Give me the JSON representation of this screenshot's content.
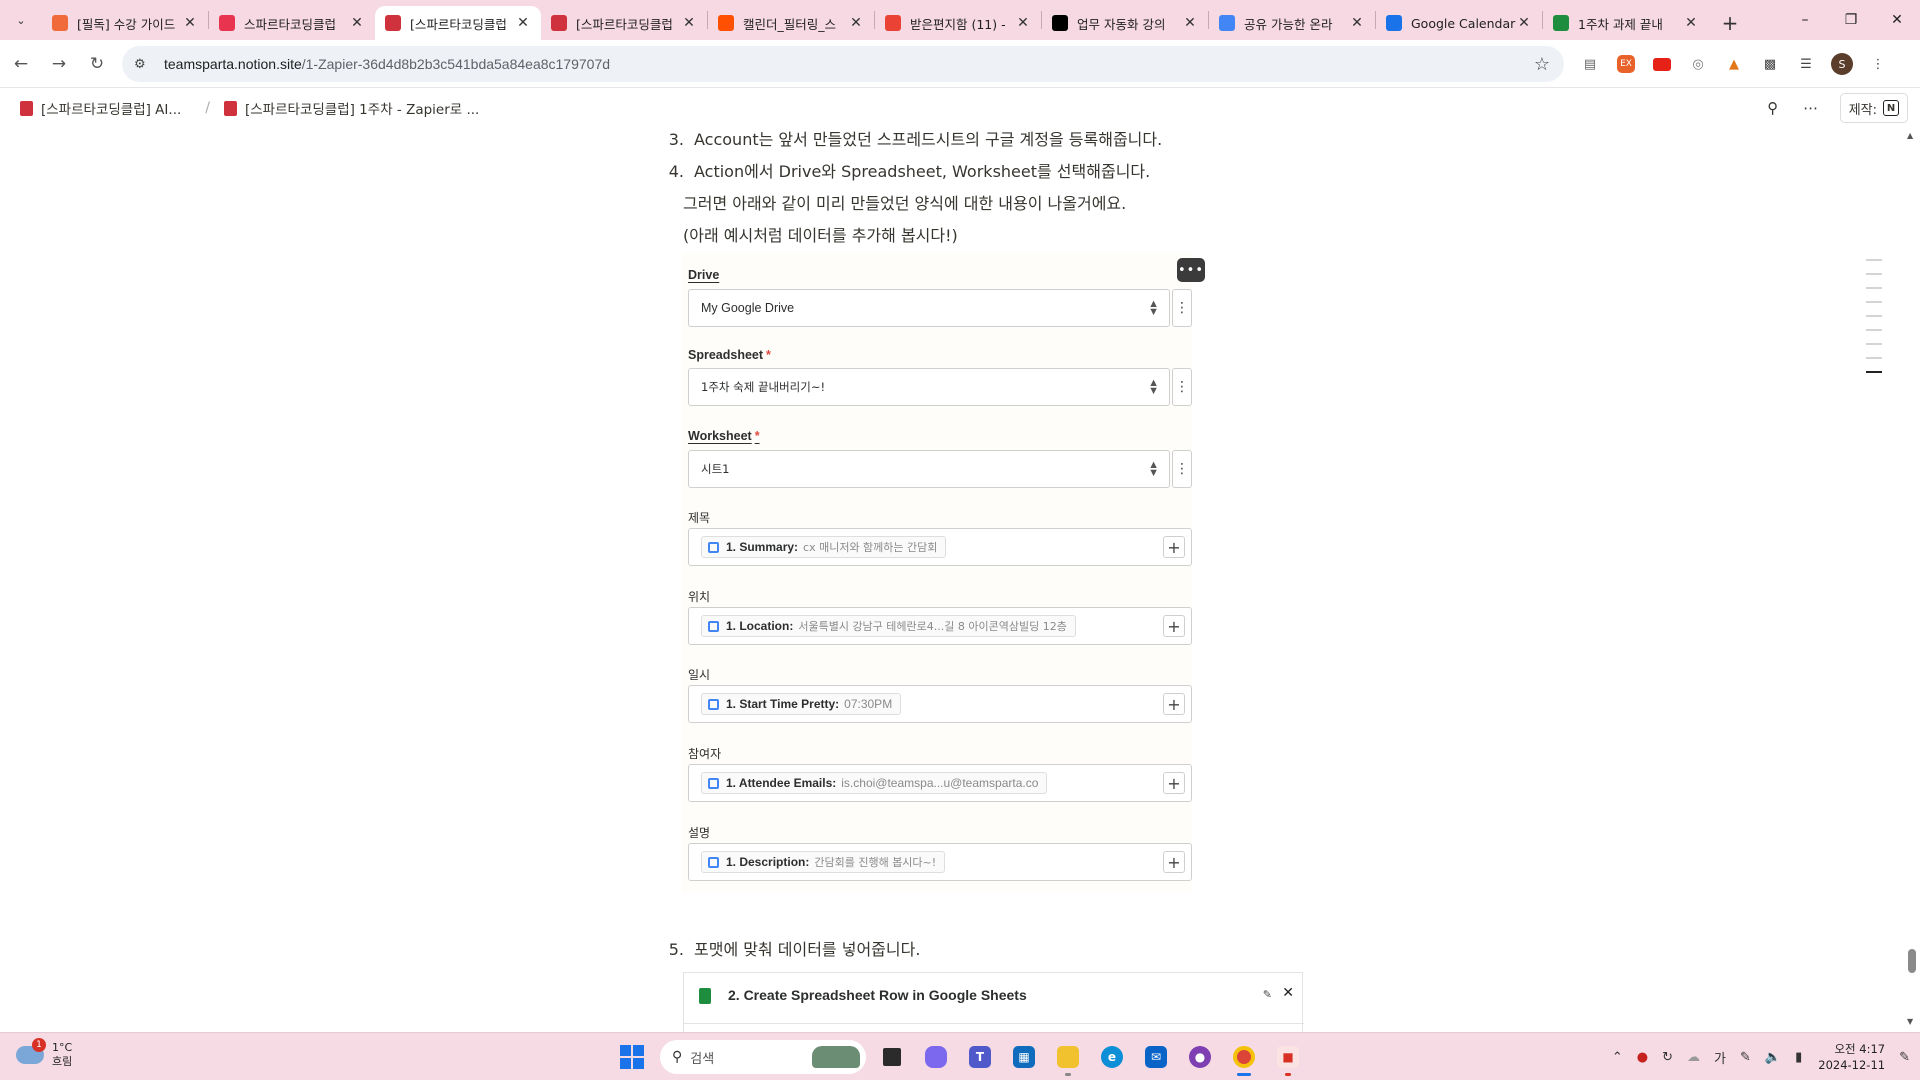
{
  "browser": {
    "tabs": [
      {
        "label": "[필독] 수강 가이드",
        "icon_color": "#f06a3a",
        "icon_name": "fire-icon",
        "active": false
      },
      {
        "label": "스파르타코딩클럽",
        "icon_color": "#e8344e",
        "icon_name": "heart-icon",
        "active": false
      },
      {
        "label": "[스파르타코딩클럽",
        "icon_color": "#d0323d",
        "icon_name": "notion-page-icon",
        "active": true
      },
      {
        "label": "[스파르타코딩클럽",
        "icon_color": "#d0323d",
        "icon_name": "notion-page-icon",
        "active": false
      },
      {
        "label": "캘린더_필터링_스",
        "icon_color": "#ff4f00",
        "icon_name": "zapier-icon",
        "active": false
      },
      {
        "label": "받은편지함 (11) -",
        "icon_color": "#ea4335",
        "icon_name": "gmail-icon",
        "active": false
      },
      {
        "label": "업무 자동화 강의",
        "icon_color": "#000000",
        "icon_name": "notion-icon",
        "active": false
      },
      {
        "label": "공유 가능한 온라",
        "icon_color": "#4285f4",
        "icon_name": "google-icon",
        "active": false
      },
      {
        "label": "Google Calendar",
        "icon_color": "#1a73e8",
        "icon_name": "calendar-icon",
        "active": false
      },
      {
        "label": "1주차 과제 끝내",
        "icon_color": "#1e8e3e",
        "icon_name": "sheets-icon",
        "active": false
      }
    ],
    "url_host": "teamsparta.notion.site",
    "url_path": "/1-Zapier-36d4d8b2b3c541bda5a84ea8c179707d"
  },
  "notion": {
    "breadcrumbs": [
      "[스파르타코딩클럽] AI...",
      "[스파르타코딩클럽] 1주차 - Zapier로 ..."
    ],
    "made_with_label": "제작:",
    "made_with_badge": "N"
  },
  "content": {
    "step3": {
      "num": "3.",
      "text": "Account는 앞서 만들었던 스프레드시트의 구글 계정을 등록해줍니다."
    },
    "step4": {
      "num": "4.",
      "text": "Action에서 Drive와 Spreadsheet, Worksheet를 선택해줍니다."
    },
    "para1": "그러면 아래와 같이 미리 만들었던 양식에 대한 내용이 나올거에요.",
    "para2": "(아래 예시처럼 데이터를 추가해 봅시다!)",
    "step5": {
      "num": "5.",
      "text": "포맷에 맞춰 데이터를 넣어줍니다."
    }
  },
  "zap_form": {
    "drive": {
      "label": "Drive",
      "value": "My Google Drive"
    },
    "spreadsheet": {
      "label": "Spreadsheet",
      "required": "*",
      "value": "1주차 숙제 끝내버리기~!"
    },
    "worksheet": {
      "label": "Worksheet",
      "required": "*",
      "value": "시트1"
    },
    "fields": [
      {
        "label": "제목",
        "key": "1. Summary:",
        "value": "cx 매니저와 함께하는 간담회"
      },
      {
        "label": "위치",
        "key": "1. Location:",
        "value": "서울특별시 강남구 테헤란로4...길 8 아이콘역삼빌딩 12층"
      },
      {
        "label": "일시",
        "key": "1. Start Time Pretty:",
        "value": "07:30PM"
      },
      {
        "label": "참여자",
        "key": "1. Attendee Emails:",
        "value": "is.choi@teamspa...u@teamsparta.co"
      },
      {
        "label": "설명",
        "key": "1. Description:",
        "value": "간담회를 진행해 봅시다~!"
      }
    ]
  },
  "step2_card": {
    "title": "2. Create Spreadsheet Row in Google Sheets"
  },
  "taskbar": {
    "weather_badge": "1",
    "temperature": "1°C",
    "condition": "흐림",
    "search_placeholder": "검색",
    "ime": "가",
    "time": "오전 4:17",
    "date": "2024-12-11"
  }
}
